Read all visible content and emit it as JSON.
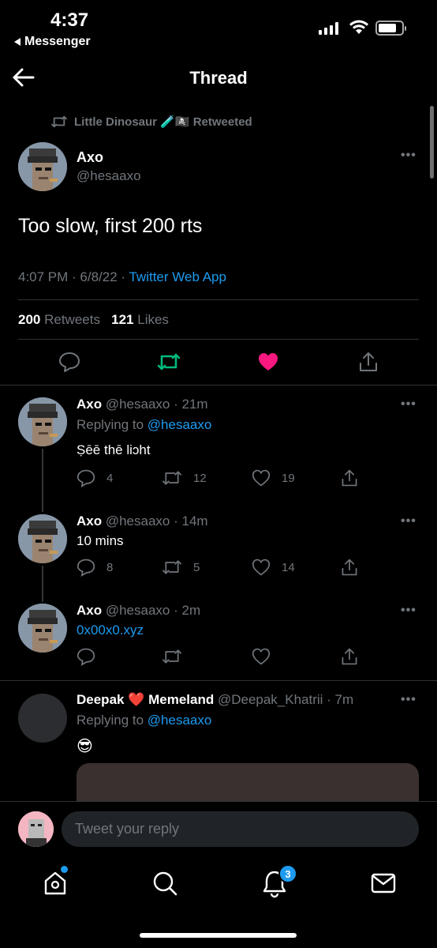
{
  "status_bar": {
    "time": "4:37",
    "back_app": "Messenger"
  },
  "header": {
    "title": "Thread"
  },
  "main_tweet": {
    "retweeted_by": "Little Dinosaur 🧪🏴‍☠️ Retweeted",
    "name": "Axo",
    "handle": "@hesaaxo",
    "text": "Too slow, first 200 rts",
    "timestamp": "4:07 PM · 6/8/22 · ",
    "source": "Twitter Web App",
    "retweet_count": "200",
    "retweet_label": " Retweets",
    "like_count": "121",
    "like_label": " Likes",
    "liked": true,
    "accent_color": "#1d9bf0",
    "retweet_color": "#00ba7c",
    "like_color": "#f91880"
  },
  "replies": [
    {
      "name": "Axo",
      "meta": " @hesaaxo · 21m",
      "replying_to_label": "Replying to ",
      "replying_to": "@hesaaxo",
      "text": "Ṣēē thē liɔht",
      "reply_count": "4",
      "retweet_count": "12",
      "like_count": "19"
    },
    {
      "name": "Axo",
      "meta": " @hesaaxo · 14m",
      "text": "10 mins",
      "reply_count": "8",
      "retweet_count": "5",
      "like_count": "14"
    },
    {
      "name": "Axo",
      "meta": " @hesaaxo · 2m",
      "text": "0x00x0.xyz",
      "reply_count": "",
      "retweet_count": "",
      "like_count": ""
    },
    {
      "name": "Deepak ❤️ Memeland",
      "meta": " @Deepak_Khatrii · 7m",
      "replying_to_label": "Replying to ",
      "replying_to": "@hesaaxo",
      "text": "😎"
    }
  ],
  "composer": {
    "placeholder": "Tweet your reply"
  },
  "tabbar": {
    "notifications_badge": "3"
  }
}
